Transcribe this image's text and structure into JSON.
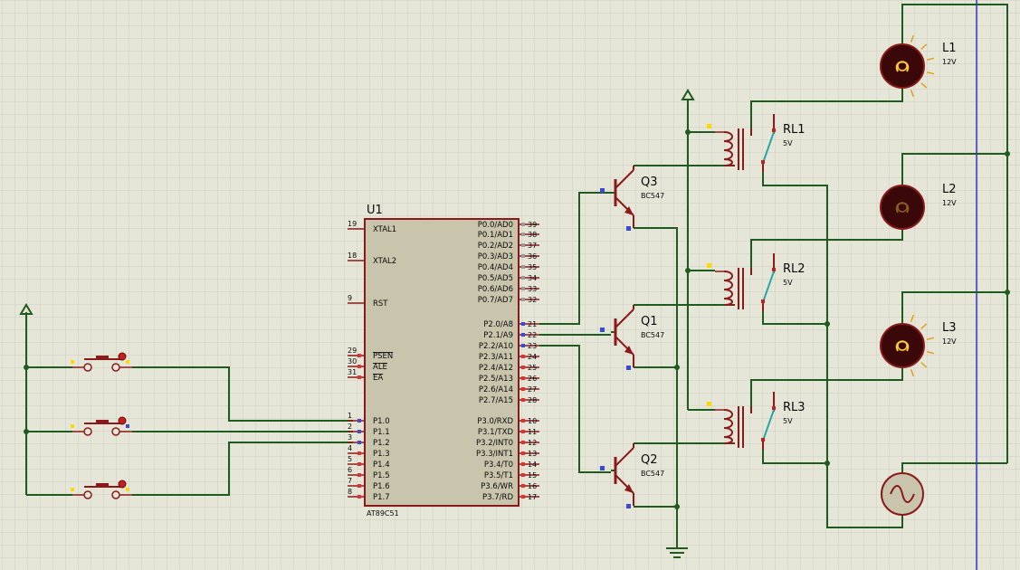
{
  "mcu": {
    "ref": "U1",
    "part": "AT89C51",
    "left_pins": [
      {
        "num": "19",
        "name": "XTAL1"
      },
      {
        "num": "18",
        "name": "XTAL2"
      },
      {
        "num": "9",
        "name": "RST"
      },
      {
        "num": "29",
        "name": "PSEN"
      },
      {
        "num": "30",
        "name": "ALE"
      },
      {
        "num": "31",
        "name": "EA"
      },
      {
        "num": "1",
        "name": "P1.0"
      },
      {
        "num": "2",
        "name": "P1.1"
      },
      {
        "num": "3",
        "name": "P1.2"
      },
      {
        "num": "4",
        "name": "P1.3"
      },
      {
        "num": "5",
        "name": "P1.4"
      },
      {
        "num": "6",
        "name": "P1.5"
      },
      {
        "num": "7",
        "name": "P1.6"
      },
      {
        "num": "8",
        "name": "P1.7"
      }
    ],
    "right_pins": [
      {
        "num": "39",
        "name": "P0.0/AD0"
      },
      {
        "num": "38",
        "name": "P0.1/AD1"
      },
      {
        "num": "37",
        "name": "P0.2/AD2"
      },
      {
        "num": "36",
        "name": "P0.3/AD3"
      },
      {
        "num": "35",
        "name": "P0.4/AD4"
      },
      {
        "num": "34",
        "name": "P0.5/AD5"
      },
      {
        "num": "33",
        "name": "P0.6/AD6"
      },
      {
        "num": "32",
        "name": "P0.7/AD7"
      },
      {
        "num": "21",
        "name": "P2.0/A8"
      },
      {
        "num": "22",
        "name": "P2.1/A9"
      },
      {
        "num": "23",
        "name": "P2.2/A10"
      },
      {
        "num": "24",
        "name": "P2.3/A11"
      },
      {
        "num": "25",
        "name": "P2.4/A12"
      },
      {
        "num": "26",
        "name": "P2.5/A13"
      },
      {
        "num": "27",
        "name": "P2.6/A14"
      },
      {
        "num": "28",
        "name": "P2.7/A15"
      },
      {
        "num": "10",
        "name": "P3.0/RXD"
      },
      {
        "num": "11",
        "name": "P3.1/TXD"
      },
      {
        "num": "12",
        "name": "P3.2/INT0"
      },
      {
        "num": "13",
        "name": "P3.3/INT1"
      },
      {
        "num": "14",
        "name": "P3.4/T0"
      },
      {
        "num": "15",
        "name": "P3.5/T1"
      },
      {
        "num": "16",
        "name": "P3.6/WR"
      },
      {
        "num": "17",
        "name": "P3.7/RD"
      }
    ]
  },
  "transistors": [
    {
      "ref": "Q3",
      "part": "BC547"
    },
    {
      "ref": "Q1",
      "part": "BC547"
    },
    {
      "ref": "Q2",
      "part": "BC547"
    }
  ],
  "relays": [
    {
      "ref": "RL1",
      "value": "5V"
    },
    {
      "ref": "RL2",
      "value": "5V"
    },
    {
      "ref": "RL3",
      "value": "5V"
    }
  ],
  "lamps": [
    {
      "ref": "L1",
      "value": "12V"
    },
    {
      "ref": "L2",
      "value": "12V"
    },
    {
      "ref": "L3",
      "value": "12V"
    }
  ],
  "colors": {
    "background": "#e6e6d8",
    "grid": "#cfcfbf",
    "wire": "#1f5a1f",
    "component": "#8a1a1a",
    "chip_fill": "#c9c4ac",
    "logic_low": "#3a4ad8",
    "logic_high": "#ffd800",
    "relay_contact": "#2aa6a6",
    "lamp_glow": "#e0a020",
    "power_line": "#3333cc"
  },
  "icons": [
    "power-terminal-icon",
    "ground-icon",
    "pushbutton-icon",
    "npn-transistor-icon",
    "relay-icon",
    "lamp-icon",
    "ac-source-icon"
  ]
}
